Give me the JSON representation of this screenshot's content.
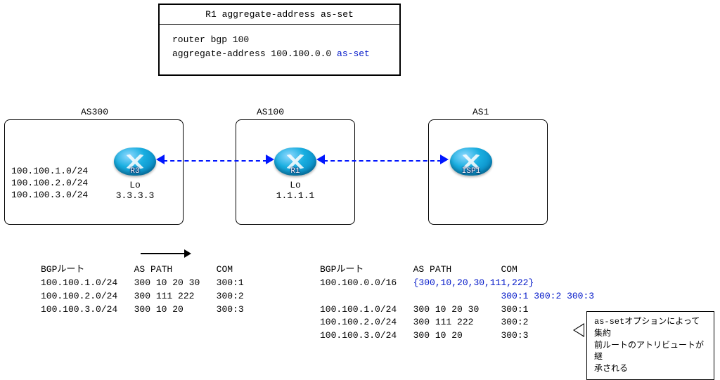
{
  "config": {
    "title": "R1 aggregate-address as-set",
    "line1": "router bgp 100",
    "line2a": "aggregate-address 100.100.0.0 ",
    "line2b": "as-set"
  },
  "as_labels": {
    "as300": "AS300",
    "as100": "AS100",
    "as1": "AS1"
  },
  "as300_routes": {
    "r1": "100.100.1.0/24",
    "r2": "100.100.2.0/24",
    "r3": "100.100.3.0/24"
  },
  "routers": {
    "r3": {
      "name": "R3",
      "sub": "Lo 3.3.3.3"
    },
    "r1": {
      "name": "R1",
      "sub": "Lo 1.1.1.1"
    },
    "isp1": {
      "name": "ISP1",
      "sub": ""
    }
  },
  "left_table": {
    "h1": "BGPルート",
    "h2": "AS PATH",
    "h3": "COM",
    "rows": [
      {
        "route": "100.100.1.0/24",
        "aspath": "300 10 20 30",
        "com": "300:1"
      },
      {
        "route": "100.100.2.0/24",
        "aspath": "300 111 222",
        "com": "300:2"
      },
      {
        "route": "100.100.3.0/24",
        "aspath": "300 10 20",
        "com": "300:3"
      }
    ]
  },
  "right_table": {
    "h1": "BGPルート",
    "h2": "AS PATH",
    "h3": "COM",
    "agg": {
      "route": "100.100.0.0/16",
      "aspath": "{300,10,20,30,111,222}",
      "com": "300:1 300:2 300:3"
    },
    "rows": [
      {
        "route": "100.100.1.0/24",
        "aspath": "300 10 20 30",
        "com": "300:1"
      },
      {
        "route": "100.100.2.0/24",
        "aspath": "300 111 222",
        "com": "300:2"
      },
      {
        "route": "100.100.3.0/24",
        "aspath": "300 10 20",
        "com": "300:3"
      }
    ]
  },
  "note": {
    "l1": "as-setオプションによって集約",
    "l2": "前ルートのアトリビュートが継",
    "l3": "承される"
  }
}
